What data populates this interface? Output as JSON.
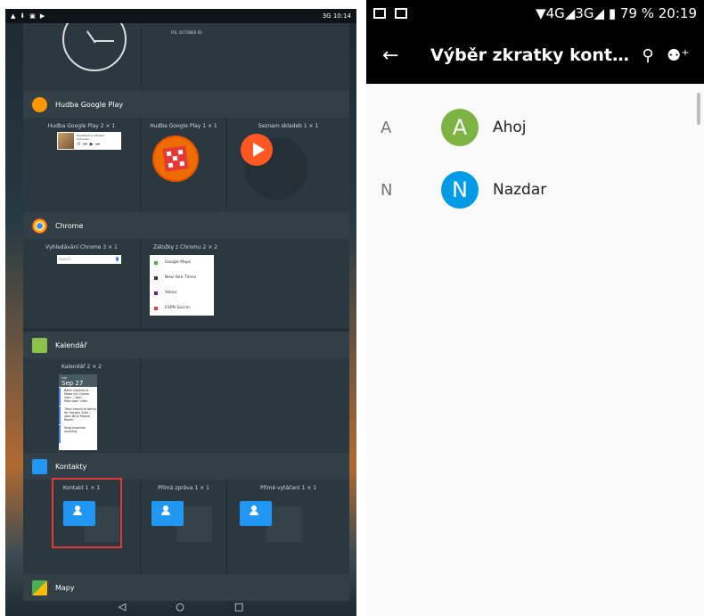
{
  "left": {
    "status_time": "10:14",
    "status_right": "3G",
    "clock_date": "FRI, OCTOBER 06",
    "apps": [
      {
        "name": "Hudba Google Play",
        "icon": "google-play-music-icon",
        "color": "#ff9800",
        "widgets": [
          "Hudba Google Play 2 × 1",
          "Hudba Google Play 1 × 1",
          "Seznam skladeb 1 × 1"
        ]
      },
      {
        "name": "Chrome",
        "icon": "chrome-icon",
        "color": "#4285f4",
        "widgets": [
          "Vyhledávání Chrome 3 × 1",
          "Záložky z Chromu 2 × 2"
        ]
      },
      {
        "name": "Kalendář",
        "icon": "calendar-icon",
        "color": "#8bc34a",
        "widgets": [
          "Kalendář 2 × 2"
        ]
      },
      {
        "name": "Kontakty",
        "icon": "contacts-icon",
        "color": "#2196f3",
        "widgets": [
          "Kontakt 1 × 1",
          "Přímá zpráva 1 × 1",
          "Přímé vytáčení 1 × 1"
        ]
      },
      {
        "name": "Mapy",
        "icon": "maps-icon",
        "color": "#4caf50",
        "widgets": []
      }
    ],
    "music_widget": {
      "title": "Heartbeat on Breeze",
      "artist": "Unknown"
    },
    "search_placeholder": "Search",
    "bookmarks": [
      "Google Maps",
      "New York Times",
      "Yahoo",
      "ESPN Soccer"
    ],
    "calendar": {
      "day": "Sep 27",
      "weekday": "TUE",
      "events": [
        "Bake Cookies & Make Ice Cream 2am – 3am Mountain View",
        "Time machine demo for Sergey 3am – 4am Blue Palace Room",
        "Stop machine uprising"
      ]
    },
    "nav": {
      "back": "◁",
      "home": "○",
      "recents": "□"
    }
  },
  "right": {
    "status": {
      "network": "▼4G◢3G◢",
      "battery": "79 %",
      "time": "20:19"
    },
    "title": "Výběr zkratky kont…",
    "contacts": [
      {
        "letter": "A",
        "initial": "A",
        "name": "Ahoj",
        "color": "#7cb342"
      },
      {
        "letter": "N",
        "initial": "N",
        "name": "Nazdar",
        "color": "#039be5"
      }
    ]
  }
}
